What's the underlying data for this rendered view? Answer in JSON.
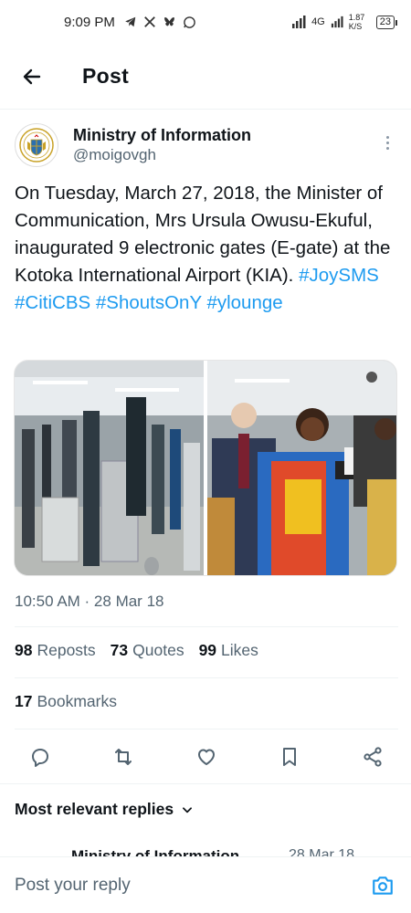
{
  "status_bar": {
    "time": "9:09 PM",
    "network": "4G",
    "speed": "1.87 K/S",
    "battery": "23"
  },
  "header": {
    "title": "Post"
  },
  "post": {
    "author_name": "Ministry of Information",
    "author_handle": "@moigovgh",
    "text": "On Tuesday, March 27, 2018, the Minister of Communication, Mrs Ursula Owusu-Ekuful, inaugurated 9 electronic gates (E-gate) at the Kotoka International Airport (KIA).",
    "hashtags": [
      "#JoySMS",
      "#CitiCBS",
      "#ShoutsOnY",
      "#ylounge"
    ],
    "timestamp": "10:50 AM · 28 Mar 18",
    "stats": {
      "reposts_count": "98",
      "reposts_label": "Reposts",
      "quotes_count": "73",
      "quotes_label": "Quotes",
      "likes_count": "99",
      "likes_label": "Likes",
      "bookmarks_count": "17",
      "bookmarks_label": "Bookmarks"
    }
  },
  "replies": {
    "sort_label": "Most relevant replies",
    "peek_name": "Ministry of Information",
    "peek_date": "28 Mar 18"
  },
  "reply_bar": {
    "placeholder": "Post your reply"
  },
  "colors": {
    "accent": "#1d9bf0",
    "text": "#0f1419",
    "secondary": "#536471"
  }
}
